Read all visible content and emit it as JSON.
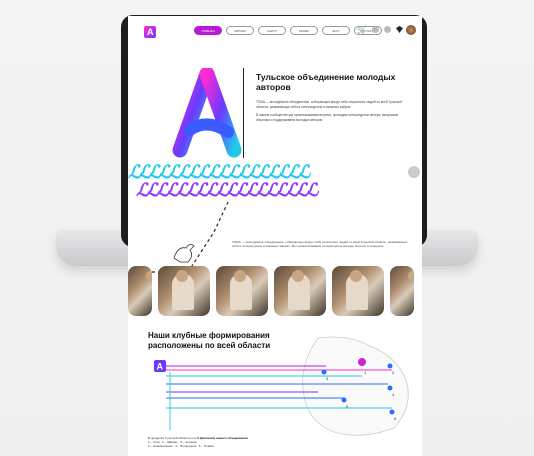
{
  "nav": {
    "logo_letter": "A",
    "items": [
      "Главная",
      "Авторы",
      "Книги",
      "Афиша",
      "Шоп",
      "Контакты"
    ]
  },
  "hero": {
    "title": "Тульское объединение молодых авторов",
    "paragraph_1": "ТОМА — молодёжное объединение, собирающее вокруг себя творческих людей со всей Тульской области, развивающих себя в литературном и смежных жанрах.",
    "paragraph_2": "В нашем сообществе мы организовываем встречи, проводим литературные вечера, выпускаем сборники и поддерживаем молодых авторов."
  },
  "mid_text": "ТОМА — молодёжное объединение, собирающее вокруг себя творческих людей со всей Тульской области, развивающих себя в литературном и смежных жанрах. Мы организовываем литературные вечера, встречи и концерты.",
  "clubs": {
    "title": "Наши клубные формирования расположены по всей области",
    "stats_prefix": "В пределах Тульской области есть",
    "stats_bold": "6 филиалов нашего объединения",
    "branches": [
      "1 – Тула",
      "2 – Новомосковск",
      "3 – Щёкино",
      "4 – Богородицк",
      "5 – Алексин",
      "6 – Плавск"
    ],
    "markers": [
      "1",
      "2",
      "3",
      "4",
      "5",
      "6"
    ]
  },
  "colors": {
    "accent": "#b91ad8",
    "pink": "#ff2ad1",
    "blue": "#2f6bff",
    "cyan": "#22c9e8",
    "violet": "#6a3bff"
  }
}
